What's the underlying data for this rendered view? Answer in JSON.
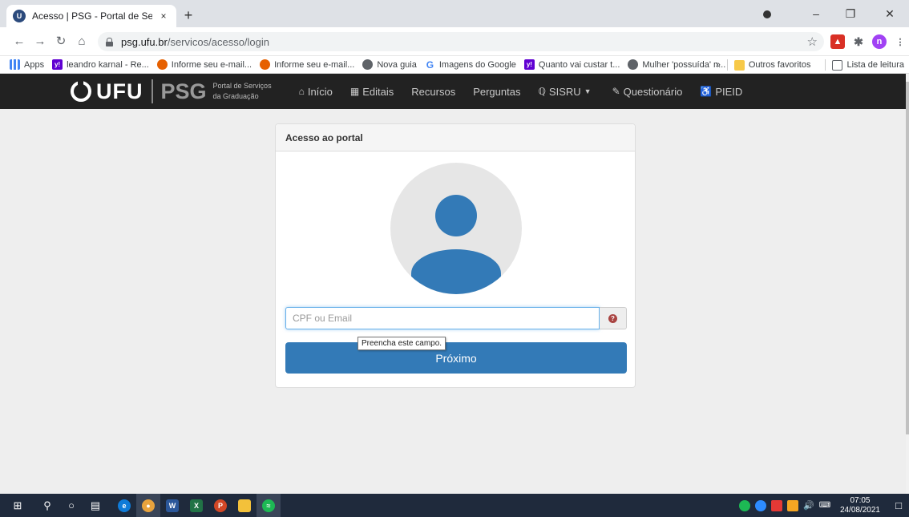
{
  "browser": {
    "tab_title": "Acesso | PSG - Portal de Serviços",
    "tab_close": "×",
    "new_tab": "+",
    "url_host": "psg.ufu.br",
    "url_path": "/servicos/acesso/login",
    "profile_initial": "n",
    "bookmarks": [
      {
        "label": "Apps",
        "icon": "apps-icon"
      },
      {
        "label": "leandro karnal - Re...",
        "icon": "yahoo-icon"
      },
      {
        "label": "Informe seu e-mail...",
        "icon": "firefox-icon"
      },
      {
        "label": "Informe seu e-mail...",
        "icon": "firefox-icon"
      },
      {
        "label": "Nova guia",
        "icon": "globe-icon"
      },
      {
        "label": "Imagens do Google",
        "icon": "google-icon"
      },
      {
        "label": "Quanto vai custar t...",
        "icon": "yahoo-icon"
      },
      {
        "label": "Mulher 'possuída' n...",
        "icon": "globe-icon"
      }
    ],
    "bookmarks_more": "»",
    "other_favorites": "Outros favoritos",
    "reading_list": "Lista de leitura"
  },
  "navbar": {
    "brand_ufu": "UFU",
    "brand_psg": "PSG",
    "brand_sub_1": "Portal de Serviços",
    "brand_sub_2": "da Graduação",
    "items": [
      {
        "label": "Início",
        "icon": "home-icon"
      },
      {
        "label": "Editais",
        "icon": "file-icon"
      },
      {
        "label": "Recursos",
        "icon": ""
      },
      {
        "label": "Perguntas",
        "icon": ""
      },
      {
        "label": "SISRU",
        "icon": "cutlery-icon"
      },
      {
        "label": "Questionário",
        "icon": "edit-icon"
      },
      {
        "label": "PIEID",
        "icon": "accessibility-icon"
      }
    ]
  },
  "login": {
    "panel_title": "Acesso ao portal",
    "input_placeholder": "CPF ou Email",
    "input_value": "",
    "next_label": "Próximo",
    "tooltip": "Preencha este campo."
  },
  "taskbar": {
    "time": "07:05",
    "date": "24/08/2021"
  },
  "colors": {
    "primary": "#337ab7",
    "navbar_bg": "#222222",
    "page_bg": "#eeeeee",
    "taskbar_bg": "#1f2a3c"
  }
}
